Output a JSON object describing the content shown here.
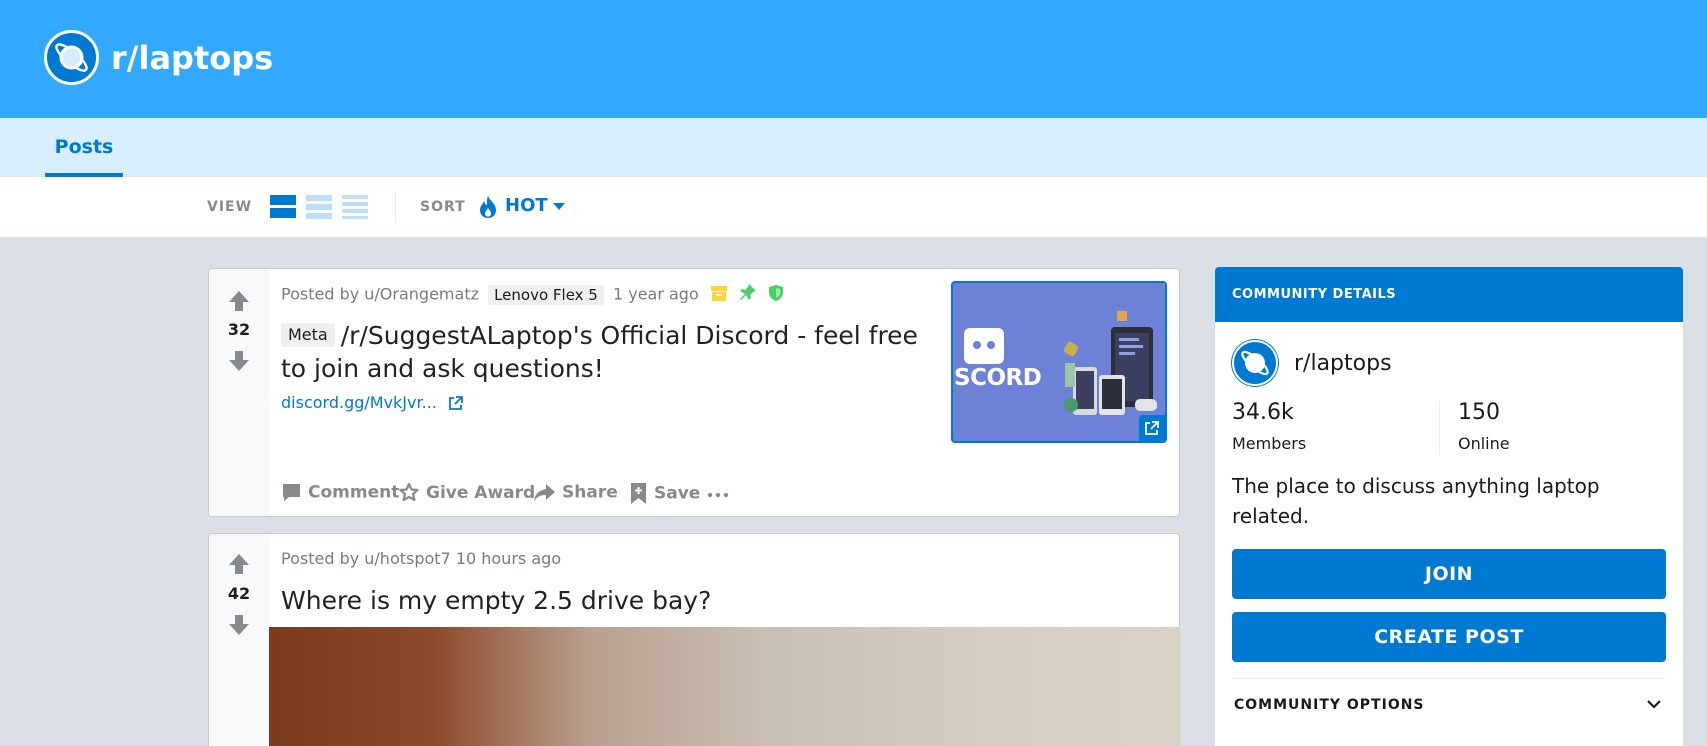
{
  "header": {
    "subreddit_title": "r/laptops",
    "icon": "planet-icon"
  },
  "tabs": {
    "posts_label": "Posts"
  },
  "toolbar": {
    "view_label": "VIEW",
    "sort_label": "SORT",
    "sort_value": "HOT",
    "view_modes": [
      "card-view-icon",
      "classic-view-icon",
      "compact-view-icon"
    ],
    "selected_view": "card-view-icon"
  },
  "posts": [
    {
      "score": "32",
      "meta_prefix": "Posted by u/Orangematz",
      "user_flair": "Lenovo Flex 5",
      "time": "1 year ago",
      "post_flair": "Meta",
      "title": "/r/SuggestALaptop's Official Discord - feel free to join and ask questions!",
      "link": "discord.gg/MvkJvr...",
      "thumbnail_text": "SCORD",
      "status_icons": [
        "archive-icon",
        "pin-icon",
        "shield-icon"
      ],
      "actions": {
        "comment": "Comment",
        "give_award": "Give Award",
        "share": "Share",
        "save": "Save"
      }
    },
    {
      "score": "42",
      "meta_prefix": "Posted by u/hotspot7",
      "time": "10 hours ago",
      "title": "Where is my empty 2.5 drive bay?"
    }
  ],
  "sidebar": {
    "header": "COMMUNITY DETAILS",
    "name": "r/laptops",
    "members_count": "34.6k",
    "members_label": "Members",
    "online_count": "150",
    "online_label": "Online",
    "description": "The place to discuss anything laptop related.",
    "join_button": "JOIN",
    "create_post_button": "CREATE POST",
    "options_label": "COMMUNITY OPTIONS"
  },
  "colors": {
    "banner": "#33a8ff",
    "tabbar": "#d7eefe",
    "accent": "#0079d3",
    "background": "#dae0e6"
  }
}
